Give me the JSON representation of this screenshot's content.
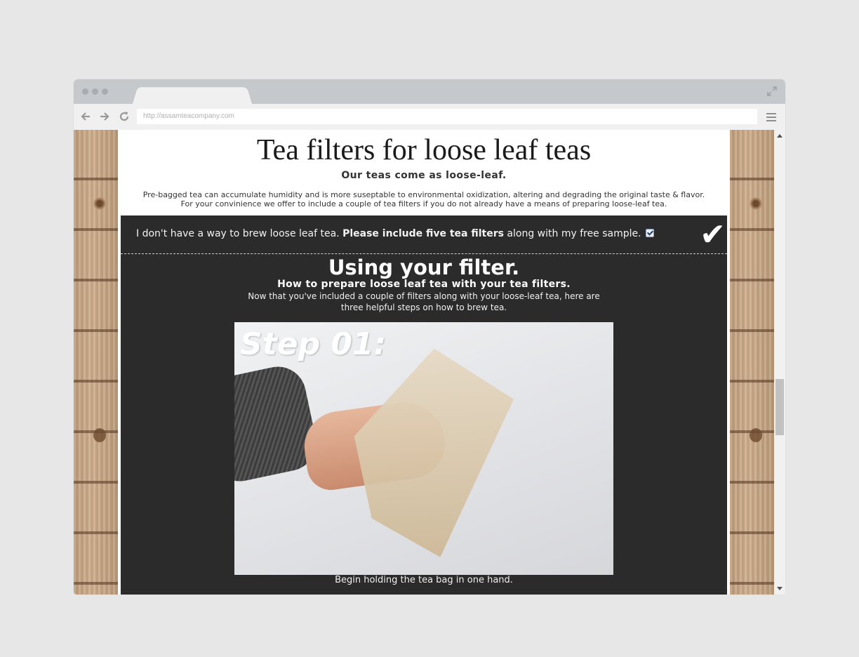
{
  "browser": {
    "url": "http://assamteacompany.com"
  },
  "page": {
    "title": "Tea filters for loose leaf teas",
    "subtitle": "Our teas come as loose-leaf.",
    "intro_line1": "Pre-bagged tea can accumulate humidity and is more suseptable to environmental oxidization, altering and degrading the original taste & flavor.",
    "intro_line2": "For your convinience we offer to include a couple of tea filters if you do not already have a means of preparing loose-leaf tea."
  },
  "option": {
    "text_before": "I don't have a way to brew loose leaf tea. ",
    "text_bold": "Please include five tea filters",
    "text_after": " along with my free sample.",
    "checked": true,
    "check_glyph": "✔"
  },
  "guide": {
    "heading": "Using your filter.",
    "subheading": "How to prepare loose leaf tea with your tea filters.",
    "description": "Now that you've included a couple of filters along with your loose-leaf tea, here are three helpful steps on how to brew tea.",
    "step_label": "Step 01:",
    "step_caption": "Begin holding the tea bag in one hand."
  },
  "colors": {
    "panel_bg": "#2b2b2b",
    "chrome_bg": "#c6c9cc"
  }
}
